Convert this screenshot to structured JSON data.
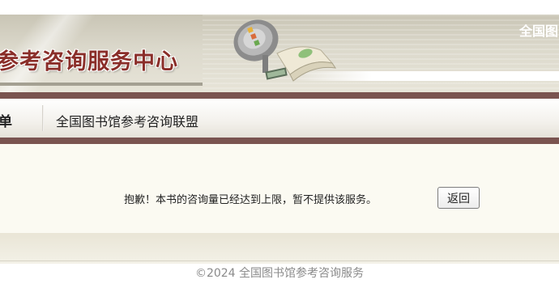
{
  "header": {
    "title": "参考咨询服务中心",
    "top_link": "全国图"
  },
  "nav": {
    "items": [
      {
        "label": "单"
      },
      {
        "label": "全国图书馆参考咨询联盟"
      }
    ]
  },
  "main": {
    "message": "抱歉！本书的咨询量已经达到上限，暂不提供该服务。",
    "back_label": "返回"
  },
  "footer": {
    "copyright": "©2024 全国图书馆参考咨询服务"
  },
  "colors": {
    "title": "#8a2e29",
    "nav_border": "#7a5450",
    "content_bg": "#fbfaf2"
  },
  "icons": {
    "logo": "satellite-dish-book-logo"
  }
}
